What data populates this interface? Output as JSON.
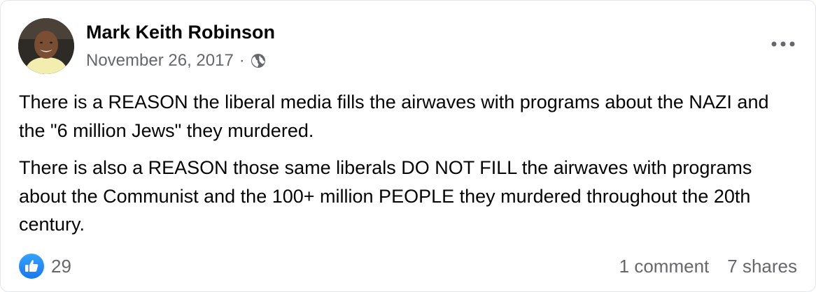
{
  "post": {
    "author": "Mark Keith Robinson",
    "date": "November 26, 2017",
    "separator": "·",
    "audience_icon": "globe-icon",
    "more_icon": "more-options-icon",
    "paragraphs": [
      "There is a REASON the liberal media fills the airwaves with programs about the NAZI and the \"6 million Jews\" they murdered.",
      "There is also a REASON those same liberals DO NOT FILL the airwaves with programs about the Communist and the 100+ million PEOPLE they murdered throughout the 20th century."
    ],
    "reactions": {
      "icon": "like-icon",
      "count": "29"
    },
    "comments": "1 comment",
    "shares": "7 shares"
  },
  "colors": {
    "text_primary": "#050505",
    "text_secondary": "#65676b",
    "like_blue": "#1877f2",
    "border": "#e4e6eb"
  }
}
